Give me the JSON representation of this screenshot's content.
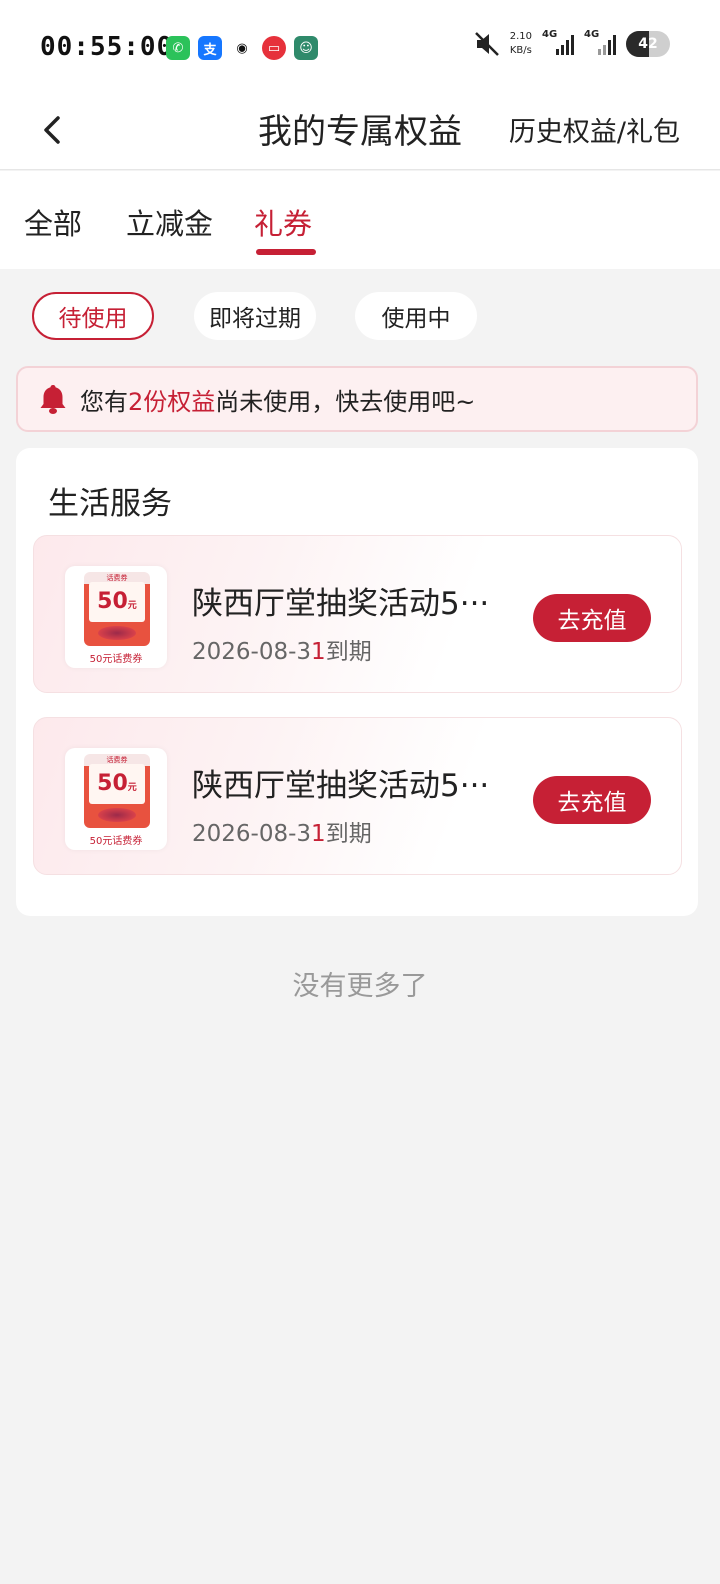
{
  "status_bar": {
    "time": "00:55:00",
    "net_speed_value": "2.10",
    "net_speed_unit": "KB/s",
    "signal_label": "4G",
    "battery": "42"
  },
  "header": {
    "title": "我的专属权益",
    "history_link": "历史权益/礼包"
  },
  "tabs": [
    {
      "label": "全部",
      "active": false
    },
    {
      "label": "立减金",
      "active": false
    },
    {
      "label": "礼券",
      "active": true
    }
  ],
  "filters": [
    {
      "label": "待使用",
      "active": true
    },
    {
      "label": "即将过期",
      "active": false
    },
    {
      "label": "使用中",
      "active": false
    }
  ],
  "notice": {
    "prefix": "您有",
    "highlight": "2份权益",
    "suffix": "尚未使用，快去使用吧~"
  },
  "section": {
    "title": "生活服务",
    "coupons": [
      {
        "name": "陕西厅堂抽奖活动5···",
        "expiry_prefix": "2026-08-3",
        "expiry_red": "1",
        "expiry_suffix": "到期",
        "button": "去充值",
        "thumb_brand": "话费券",
        "thumb_amount": "50",
        "thumb_unit": "元",
        "thumb_caption": "50元话费券"
      },
      {
        "name": "陕西厅堂抽奖活动5···",
        "expiry_prefix": "2026-08-3",
        "expiry_red": "1",
        "expiry_suffix": "到期",
        "button": "去充值",
        "thumb_brand": "话费券",
        "thumb_amount": "50",
        "thumb_unit": "元",
        "thumb_caption": "50元话费券"
      }
    ]
  },
  "footer": {
    "no_more": "没有更多了"
  },
  "colors": {
    "accent": "#c62035",
    "background": "#f3f3f3",
    "notice_bg": "#fdf0f1"
  }
}
